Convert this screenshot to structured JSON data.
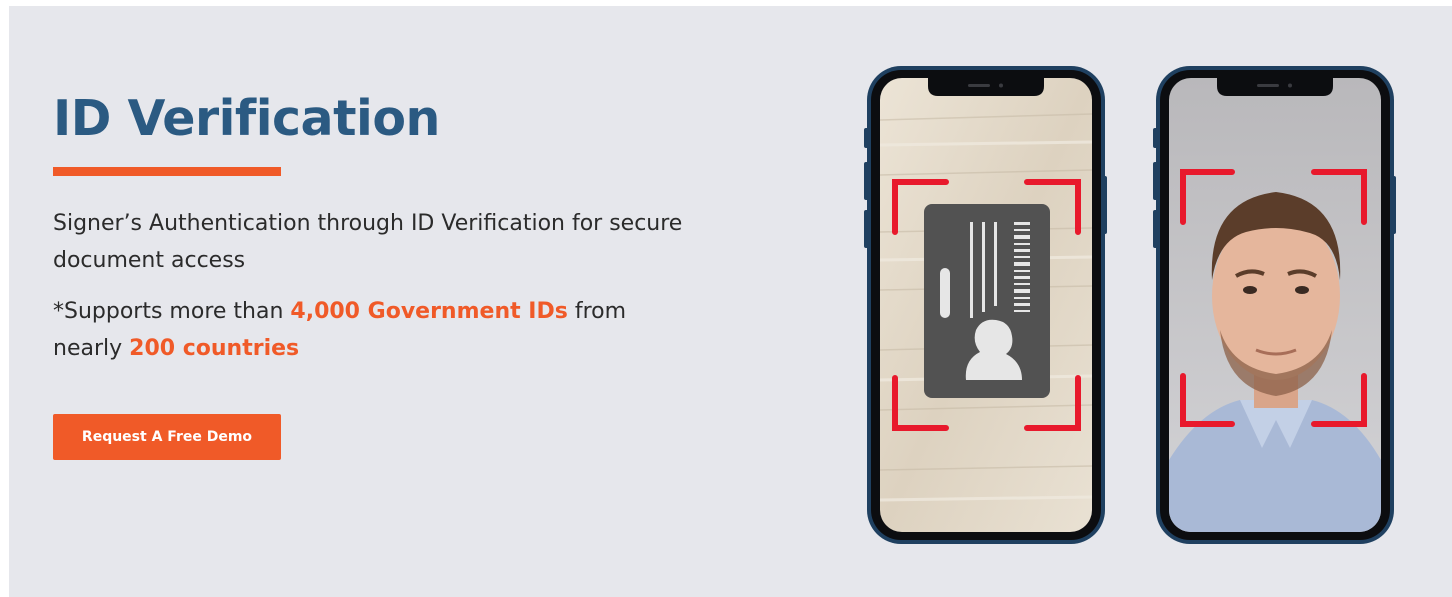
{
  "hero": {
    "title": "ID Verification",
    "description": {
      "line1": "Signer’s Authentication through ID Verification for secure document access",
      "line2_prefix": "*Supports more than ",
      "line2_highlight1": "4,000 Government IDs",
      "line2_middle": " from nearly ",
      "line2_highlight2": "200 countries"
    },
    "cta_label": "Request A Free Demo"
  },
  "colors": {
    "brand_blue": "#2b5a82",
    "accent_orange": "#f05a28",
    "scan_frame_red": "#e8192c",
    "background": "#e6e7ec"
  },
  "illustration": {
    "left_phone_content": "id-card-icon",
    "right_phone_content": "face-photo"
  }
}
